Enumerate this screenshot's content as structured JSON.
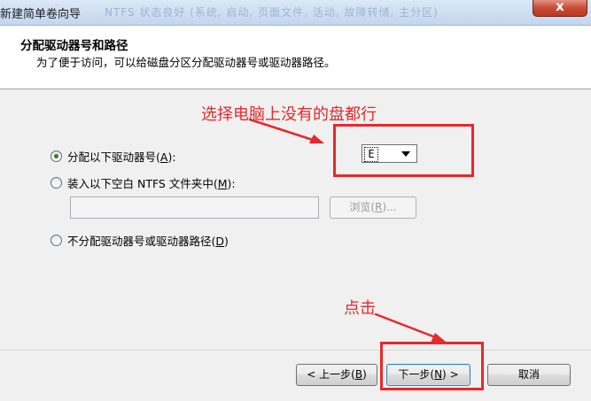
{
  "window": {
    "title": "新建简单卷向导",
    "background_text": "NTFS        状态良好 (系统, 启动, 页面文件, 活动, 故障转储, 主分区)",
    "close_label": "x"
  },
  "header": {
    "title": "分配驱动器号和路径",
    "subtitle": "为了便于访问，可以给磁盘分区分配驱动器号或驱动器路径。"
  },
  "options": {
    "assign_letter": {
      "label": "分配以下驱动器号",
      "mnemonic_open": "(",
      "mnemonic": "A",
      "mnemonic_close": "):"
    },
    "mount_folder": {
      "label": "装入以下空白 NTFS 文件夹中",
      "mnemonic_open": "(",
      "mnemonic": "M",
      "mnemonic_close": "):"
    },
    "no_assign": {
      "label": "不分配驱动器号或驱动器路径",
      "mnemonic_open": "(",
      "mnemonic": "D",
      "mnemonic_close": ")"
    }
  },
  "drive_select": {
    "value": "E"
  },
  "path_input": {
    "value": ""
  },
  "browse_button": {
    "label_prefix": "浏览",
    "mnemonic_open": "(",
    "mnemonic": "R",
    "mnemonic_close": ")..."
  },
  "footer": {
    "back": {
      "arrow": "<",
      "label": "上一步",
      "mnemonic_open": "(",
      "mnemonic": "B",
      "mnemonic_close": ")"
    },
    "next": {
      "label": "下一步",
      "mnemonic_open": "(",
      "mnemonic": "N",
      "mnemonic_close": ")",
      "arrow": ">"
    },
    "cancel": {
      "label": "取消"
    }
  },
  "annotations": {
    "select_hint": "选择电脑上没有的盘都行",
    "click_hint": "点击",
    "color": "#e8282b"
  }
}
